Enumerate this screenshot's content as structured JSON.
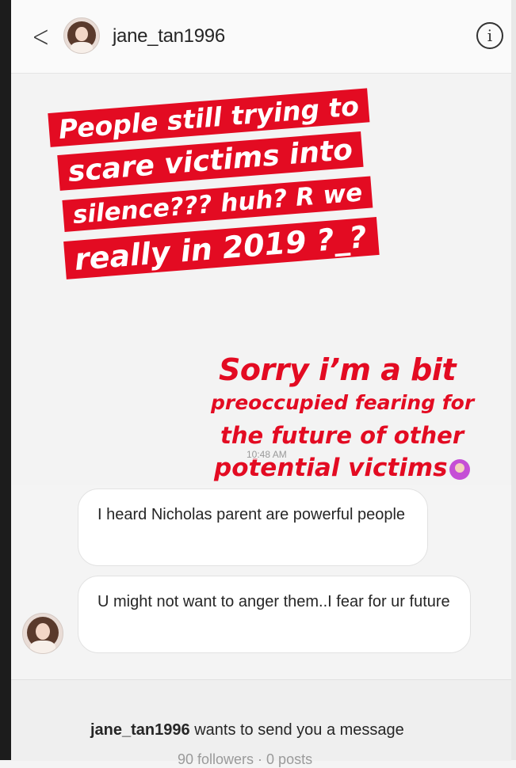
{
  "header": {
    "username": "jane_tan1996",
    "back_icon": "<",
    "info_icon": "i"
  },
  "story": {
    "headline_lines": [
      "People still trying to",
      "scare victims into",
      "silence??? huh? R we",
      "really in 2019 ?_?"
    ],
    "reply_lines": [
      "Sorry i’m a bit",
      "preoccupied fearing for",
      "the future of other",
      "potential victims"
    ],
    "headline_bg": "#e30b22",
    "reply_color": "#e30b22"
  },
  "thread": {
    "timestamp": "10:48 AM",
    "messages": [
      "I heard Nicholas parent are powerful people",
      "U might not want to anger them..I fear for ur future"
    ]
  },
  "request": {
    "username": "jane_tan1996",
    "text": " wants to send you a message",
    "followers_partial": "90 followers · 0 posts"
  }
}
